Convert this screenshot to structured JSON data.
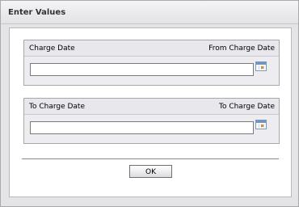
{
  "dialog": {
    "title": "Enter Values"
  },
  "groups": [
    {
      "label": "Charge Date",
      "right_label": "From Charge Date",
      "input_value": ""
    },
    {
      "label": "To Charge Date",
      "right_label": "To Charge Date",
      "input_value": ""
    }
  ],
  "icons": {
    "calendar": "calendar-icon"
  },
  "footer": {
    "ok_label": "OK"
  }
}
